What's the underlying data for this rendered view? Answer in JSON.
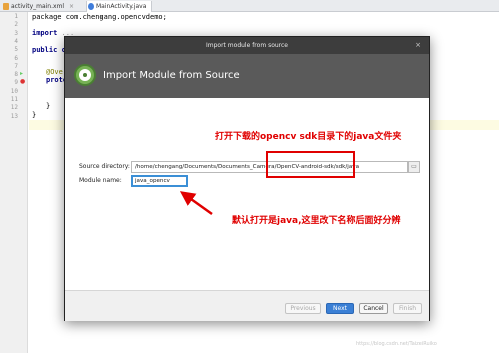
{
  "tabs": [
    {
      "label": "activity_main.xml"
    },
    {
      "label": "MainActivity.java"
    }
  ],
  "editor": {
    "line_numbers": [
      "1",
      "2",
      "3",
      "4",
      "5",
      "6",
      "7",
      "8",
      "9",
      "10",
      "11",
      "12",
      "13"
    ],
    "package_line": "package com.chengang.opencvdemo;",
    "import_kw": "import",
    "import_rest": " ...",
    "class_kw": "public cl",
    "override_text": "@Over",
    "protected_text": "prote",
    "brace_mid": "}",
    "brace_end": "}"
  },
  "dialog": {
    "window_title": "Import module from source",
    "close_glyph": "×",
    "heading": "Import Module from Source",
    "source_label": "Source directory:",
    "source_path": "/home/chengang/Documents/Documents_Camera/OpenCV-android-sdk/sdk/java",
    "browse_glyph": "▭",
    "module_label": "Module name:",
    "module_value": "java_opencv",
    "buttons": {
      "previous": "Previous",
      "next": "Next",
      "cancel": "Cancel",
      "finish": "Finish"
    }
  },
  "annotations": {
    "top_note": "打开下载的opencv sdk目录下的java文件夹",
    "bottom_note": "默认打开是java,这里改下名称后面好分辨",
    "color": "#e00000"
  },
  "watermark": "https://blog.csdn.net/TaizeiRuiko"
}
